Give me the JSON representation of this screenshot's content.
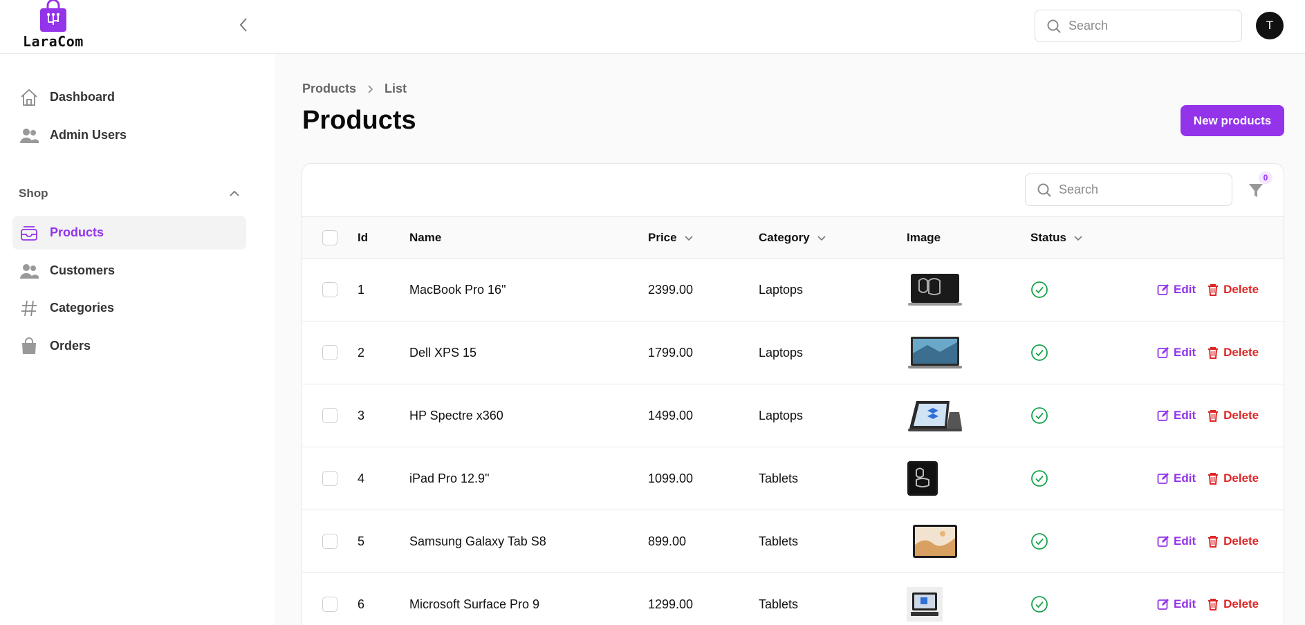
{
  "app": {
    "brand": "LaraCom"
  },
  "header": {
    "search_placeholder": "Search",
    "avatar_initial": "T"
  },
  "sidebar": {
    "items": [
      {
        "label": "Dashboard",
        "icon": "home-icon"
      },
      {
        "label": "Admin Users",
        "icon": "users-icon"
      }
    ],
    "group": {
      "label": "Shop",
      "items": [
        {
          "label": "Products",
          "icon": "inbox-icon",
          "active": true
        },
        {
          "label": "Customers",
          "icon": "users-icon"
        },
        {
          "label": "Categories",
          "icon": "hashtag-icon"
        },
        {
          "label": "Orders",
          "icon": "shopping-bag-icon"
        }
      ]
    }
  },
  "breadcrumbs": [
    "Products",
    "List"
  ],
  "page": {
    "title": "Products",
    "new_button": "New products"
  },
  "table": {
    "search_placeholder": "Search",
    "filter_count": "0",
    "columns": {
      "id": "Id",
      "name": "Name",
      "price": "Price",
      "category": "Category",
      "image": "Image",
      "status": "Status"
    },
    "actions": {
      "edit": "Edit",
      "delete": "Delete"
    },
    "rows": [
      {
        "id": "1",
        "name": "MacBook Pro 16\"",
        "price": "2399.00",
        "category": "Laptops",
        "image": "macbook-image",
        "status": "active"
      },
      {
        "id": "2",
        "name": "Dell XPS 15",
        "price": "1799.00",
        "category": "Laptops",
        "image": "laptop-image",
        "status": "active"
      },
      {
        "id": "3",
        "name": "HP Spectre x360",
        "price": "1499.00",
        "category": "Laptops",
        "image": "convertible-image",
        "status": "active"
      },
      {
        "id": "4",
        "name": "iPad Pro 12.9\"",
        "price": "1099.00",
        "category": "Tablets",
        "image": "ipad-image",
        "status": "active"
      },
      {
        "id": "5",
        "name": "Samsung Galaxy Tab S8",
        "price": "899.00",
        "category": "Tablets",
        "image": "tablet-image",
        "status": "active"
      },
      {
        "id": "6",
        "name": "Microsoft Surface Pro 9",
        "price": "1299.00",
        "category": "Tablets",
        "image": "surface-image",
        "status": "active"
      }
    ]
  },
  "colors": {
    "accent": "#9333ea",
    "danger": "#dc2626",
    "success": "#16a34a"
  }
}
